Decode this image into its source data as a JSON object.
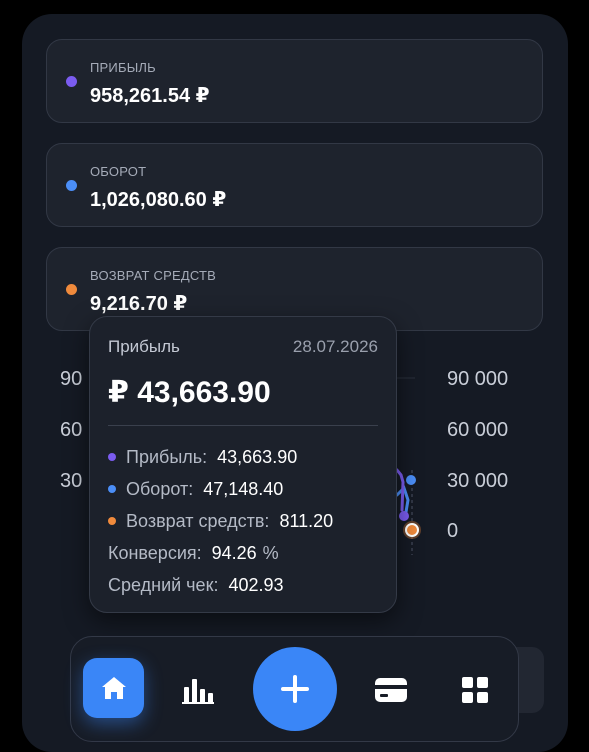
{
  "stats": [
    {
      "label": "ПРИБЫЛЬ",
      "value": "958,261.54 ₽",
      "color": "#7b5cf0"
    },
    {
      "label": "ОБОРОТ",
      "value": "1,026,080.60 ₽",
      "color": "#4b8ef7"
    },
    {
      "label": "ВОЗВРАТ СРЕДСТВ",
      "value": "9,216.70 ₽",
      "color": "#f08a3c"
    }
  ],
  "chart": {
    "left_axis": [
      "90",
      "60",
      "30"
    ],
    "right_axis": [
      "90 000",
      "60 000",
      "30 000",
      "0"
    ]
  },
  "tooltip": {
    "title": "Прибыль",
    "date": "28.07.2026",
    "main_value": "₽ 43,663.90",
    "rows": [
      {
        "label": "Прибыль:",
        "value": "43,663.90",
        "color": "#7b5cf0"
      },
      {
        "label": "Оборот:",
        "value": "47,148.40",
        "color": "#4b8ef7"
      },
      {
        "label": "Возврат средств:",
        "value": "811.20",
        "color": "#f08a3c"
      }
    ],
    "conversion_label": "Конверсия:",
    "conversion_value": "94.26",
    "conversion_unit": "%",
    "avg_check_label": "Средний чек:",
    "avg_check_value": "402.93"
  },
  "nav": {
    "icons": [
      "home-icon",
      "bar-chart-icon",
      "plus-icon",
      "card-icon",
      "grid-icon"
    ],
    "accent": "#3a86f7"
  }
}
